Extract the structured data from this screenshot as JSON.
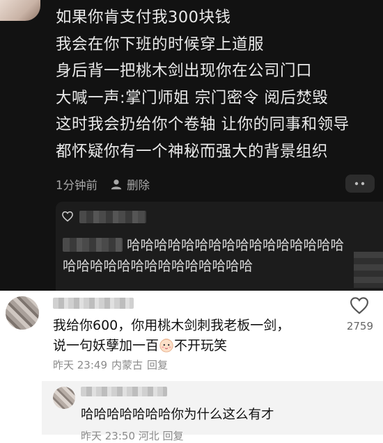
{
  "post": {
    "lines": [
      "如果你肯支付我300块钱",
      "我会在你下班的时候穿上道服",
      "身后背一把桃木剑出现你在公司门口",
      "大喊一声:掌门师姐 宗门密令 阅后焚毁",
      "这时我会扔给你个卷轴 让你的同事和领导",
      "都怀疑你有一个神秘而强大的背景组织"
    ],
    "time": "1分钟前",
    "delete_label": "删除",
    "more_icon": "more-dots-icon",
    "user_icon": "person-icon"
  },
  "reply": {
    "heart_icon": "heart-outline-icon",
    "text_line1": "哈哈哈哈哈哈哈哈哈哈哈哈哈哈哈哈",
    "text_line2": "哈哈哈哈哈哈哈哈哈哈哈哈哈哈"
  },
  "comment": {
    "line1": "我给你600，你用桃木剑刺我老板一剑，",
    "line2_before": "说一句妖孽加一百",
    "line2_after": "不开玩笑",
    "emoji_icon": "baby-face-emoji-icon",
    "time": "昨天 23:49",
    "location": "内蒙古",
    "reply_label": "回复",
    "like_count": "2759",
    "heart_icon": "heart-outline-icon"
  },
  "sub_reply": {
    "text": "哈哈哈哈哈哈哈你为什么这么有才",
    "meta": "昨天 23:50 河北 回复"
  },
  "colors": {
    "dark_bg": "#121212",
    "reply_box_bg": "#1c1c1c",
    "light_bg": "#ffffff",
    "subreply_bg": "#f3f3f3"
  }
}
